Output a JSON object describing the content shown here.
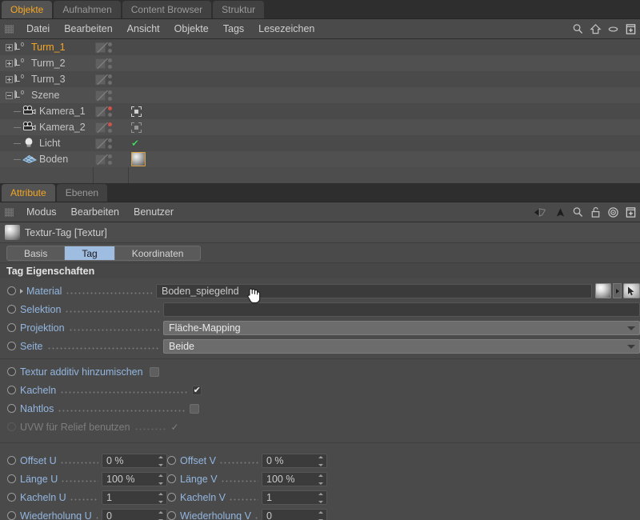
{
  "object_manager": {
    "tabs": [
      {
        "label": "Objekte",
        "active": true
      },
      {
        "label": "Aufnahmen",
        "active": false
      },
      {
        "label": "Content Browser",
        "active": false
      },
      {
        "label": "Struktur",
        "active": false
      }
    ],
    "menu": [
      "Datei",
      "Bearbeiten",
      "Ansicht",
      "Objekte",
      "Tags",
      "Lesezeichen"
    ],
    "toolbar_icons": [
      "search-icon",
      "home-icon",
      "link-icon",
      "layout-icon"
    ],
    "rows": [
      {
        "label": "Turm_1",
        "icon": "null-object-icon",
        "indent": 0,
        "expander": "plus",
        "selected": true,
        "tags": []
      },
      {
        "label": "Turm_2",
        "icon": "null-object-icon",
        "indent": 0,
        "expander": "plus",
        "selected": false,
        "tags": []
      },
      {
        "label": "Turm_3",
        "icon": "null-object-icon",
        "indent": 0,
        "expander": "plus",
        "selected": false,
        "tags": []
      },
      {
        "label": "Szene",
        "icon": "null-object-icon",
        "indent": 0,
        "expander": "minus",
        "selected": false,
        "tags": []
      },
      {
        "label": "Kamera_1",
        "icon": "camera-icon",
        "indent": 1,
        "expander": "none",
        "selected": false,
        "tags": [
          "target-tag-icon"
        ],
        "dot": "red"
      },
      {
        "label": "Kamera_2",
        "icon": "camera-icon",
        "indent": 1,
        "expander": "none",
        "selected": false,
        "tags": [
          "target-tag-dim-icon"
        ],
        "dot": "red"
      },
      {
        "label": "Licht",
        "icon": "light-icon",
        "indent": 1,
        "expander": "none",
        "selected": false,
        "tags": [
          "check-tag-icon"
        ]
      },
      {
        "label": "Boden",
        "icon": "floor-icon",
        "indent": 1,
        "expander": "none",
        "selected": false,
        "tags": [
          "texture-tag-icon"
        ]
      }
    ]
  },
  "attribute_manager": {
    "tabs": [
      {
        "label": "Attribute",
        "active": true
      },
      {
        "label": "Ebenen",
        "active": false
      }
    ],
    "menu": [
      "Modus",
      "Bearbeiten",
      "Benutzer"
    ],
    "toolbar_icons": [
      "back-arrow-icon",
      "up-arrow-icon",
      "search-icon",
      "lock-icon",
      "target-icon",
      "layout-icon"
    ],
    "title": "Textur-Tag [Textur]",
    "segments": [
      {
        "label": "Basis",
        "active": false
      },
      {
        "label": "Tag",
        "active": true
      },
      {
        "label": "Koordinaten",
        "active": false
      }
    ],
    "group_title": "Tag Eigenschaften",
    "properties": [
      {
        "name": "material",
        "label": "Material",
        "type": "material-field",
        "value": "Boden_spiegelnd"
      },
      {
        "name": "selektion",
        "label": "Selektion",
        "type": "text-field",
        "value": ""
      },
      {
        "name": "projektion",
        "label": "Projektion",
        "type": "combo",
        "value": "Fläche-Mapping"
      },
      {
        "name": "seite",
        "label": "Seite",
        "type": "combo",
        "value": "Beide"
      }
    ],
    "checkboxes": [
      {
        "name": "textur-additiv",
        "label": "Textur additiv hinzumischen",
        "checked": false,
        "disabled": false,
        "dotted": false
      },
      {
        "name": "kacheln",
        "label": "Kacheln",
        "checked": true,
        "disabled": false,
        "dotted": true
      },
      {
        "name": "nahtlos",
        "label": "Nahtlos",
        "checked": false,
        "disabled": false,
        "dotted": true
      },
      {
        "name": "uvw-relief",
        "label": "UVW für Relief benutzen",
        "checked": true,
        "disabled": true,
        "dotted": true
      }
    ],
    "numeric_rows": [
      [
        {
          "name": "offset-u",
          "label": "Offset U",
          "value": "0 %"
        },
        {
          "name": "offset-v",
          "label": "Offset V",
          "value": "0 %"
        }
      ],
      [
        {
          "name": "laenge-u",
          "label": "Länge U",
          "value": "100 %"
        },
        {
          "name": "laenge-v",
          "label": "Länge V",
          "value": "100 %"
        }
      ],
      [
        {
          "name": "kacheln-u",
          "label": "Kacheln U",
          "value": "1"
        },
        {
          "name": "kacheln-v",
          "label": "Kacheln V",
          "value": "1"
        }
      ],
      [
        {
          "name": "wiederholung-u",
          "label": "Wiederholung U",
          "value": "0"
        },
        {
          "name": "wiederholung-v",
          "label": "Wiederholung V",
          "value": "0"
        }
      ]
    ]
  },
  "colors": {
    "accent": "#f5a623",
    "label_blue": "#93b6e0",
    "selection_blue": "#9fbde0",
    "panel_bg": "#4a4a4a",
    "tag_highlight": "#d8a145"
  }
}
